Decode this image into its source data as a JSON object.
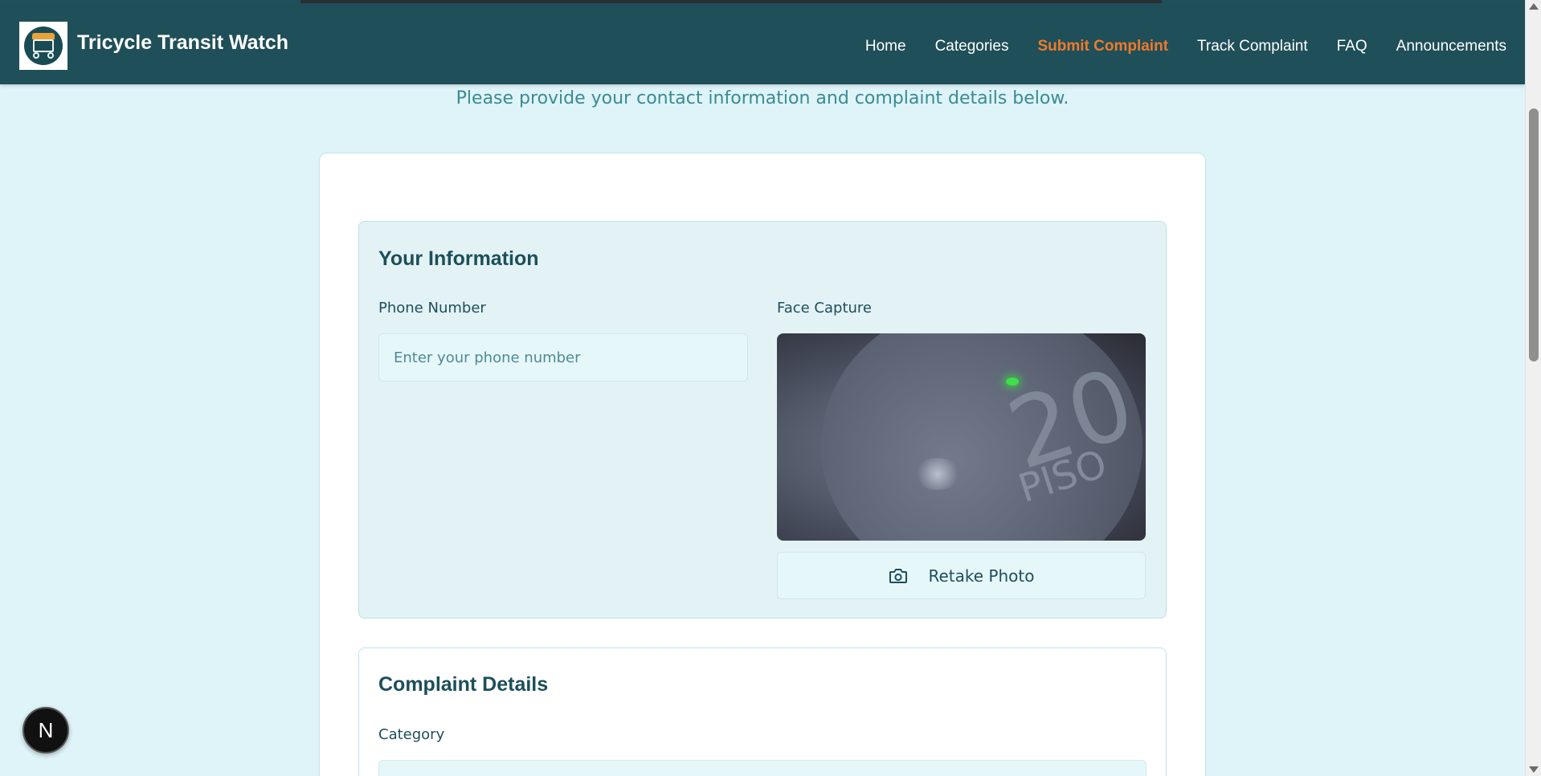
{
  "app": {
    "brand": "Tricycle Transit Watch",
    "logo_icon": "tricycle-logo-icon"
  },
  "nav": {
    "items": [
      {
        "label": "Home",
        "active": false
      },
      {
        "label": "Categories",
        "active": false
      },
      {
        "label": "Submit Complaint",
        "active": true
      },
      {
        "label": "Track Complaint",
        "active": false
      },
      {
        "label": "FAQ",
        "active": false
      },
      {
        "label": "Announcements",
        "active": false
      }
    ]
  },
  "page": {
    "subtitle": "Please provide your contact information and complaint details below."
  },
  "your_information": {
    "title": "Your Information",
    "phone_label": "Phone Number",
    "phone_placeholder": "Enter your phone number",
    "phone_value": "",
    "face_label": "Face Capture",
    "photo_text_number": "20",
    "photo_text_word": "PISO",
    "retake_label": "Retake Photo",
    "retake_icon": "camera-icon"
  },
  "complaint_details": {
    "title": "Complaint Details",
    "category_label": "Category"
  },
  "badge": {
    "letter": "N"
  },
  "colors": {
    "header_bg": "#1f4f59",
    "page_bg": "#def4f8",
    "active_nav": "#f07a2a",
    "section_bg": "#e2f2f5",
    "heading": "#1c4f5a"
  }
}
